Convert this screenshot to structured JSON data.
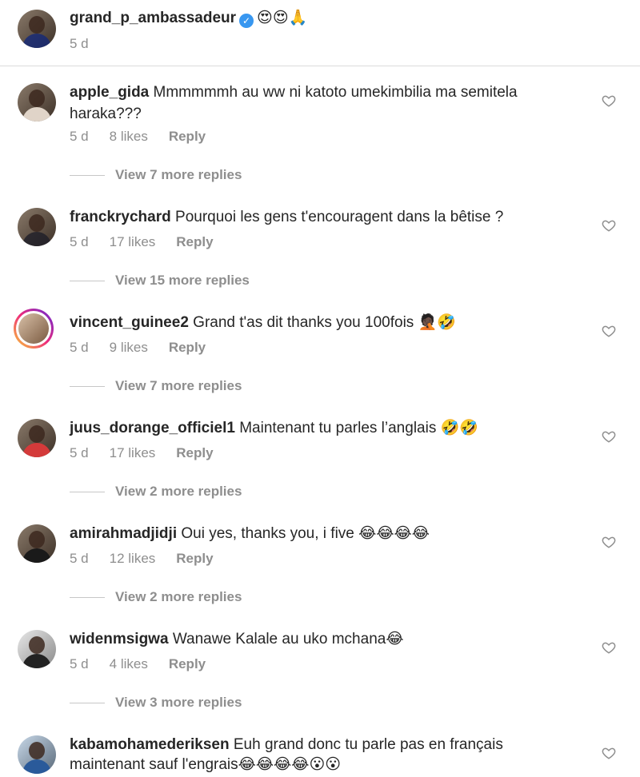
{
  "caption": {
    "username": "grand_p_ambassadeur",
    "emoji_text": "😍😍🙏",
    "time": "5 d"
  },
  "comments": [
    {
      "username": "apple_gida",
      "text_line1": "Mmmmmmh au ww ni katoto umekimbilia ma semitela",
      "text_line2": "haraka???",
      "time": "5 d",
      "likes": "8 likes",
      "reply": "Reply",
      "more": "View 7 more replies"
    },
    {
      "username": "franckrychard",
      "text_line1": "Pourquoi les gens t'encouragent dans la bêtise ?",
      "time": "5 d",
      "likes": "17 likes",
      "reply": "Reply",
      "more": "View 15 more replies"
    },
    {
      "username": "vincent_guinee2",
      "text_line1": "Grand t'as dit thanks you 100fois 🤦🏿🤣",
      "time": "5 d",
      "likes": "9 likes",
      "reply": "Reply",
      "more": "View 7 more replies"
    },
    {
      "username": "juus_dorange_officiel1",
      "text_line1": "Maintenant tu parles l’anglais 🤣🤣",
      "time": "5 d",
      "likes": "17 likes",
      "reply": "Reply",
      "more": "View 2 more replies"
    },
    {
      "username": "amirahmadjidji",
      "text_line1": "Oui yes, thanks you, i five 😂😂😂😂",
      "time": "5 d",
      "likes": "12 likes",
      "reply": "Reply",
      "more": "View 2 more replies"
    },
    {
      "username": "widenmsigwa",
      "text_line1": "Wanawe Kalale au uko mchana😂",
      "time": "5 d",
      "likes": "4 likes",
      "reply": "Reply",
      "more": "View 3 more replies"
    },
    {
      "username": "kabamohamederiksen",
      "text_line1": "Euh grand donc tu parle pas en français",
      "text_line2": "maintenant sauf l'engrais😂😂😂😂😮😮"
    }
  ],
  "colors": {
    "text": "#262626",
    "muted": "#8e8e8e",
    "verified": "#3897f0"
  },
  "icons": {
    "like": "heart-outline-icon",
    "verified": "verified-badge-icon"
  }
}
